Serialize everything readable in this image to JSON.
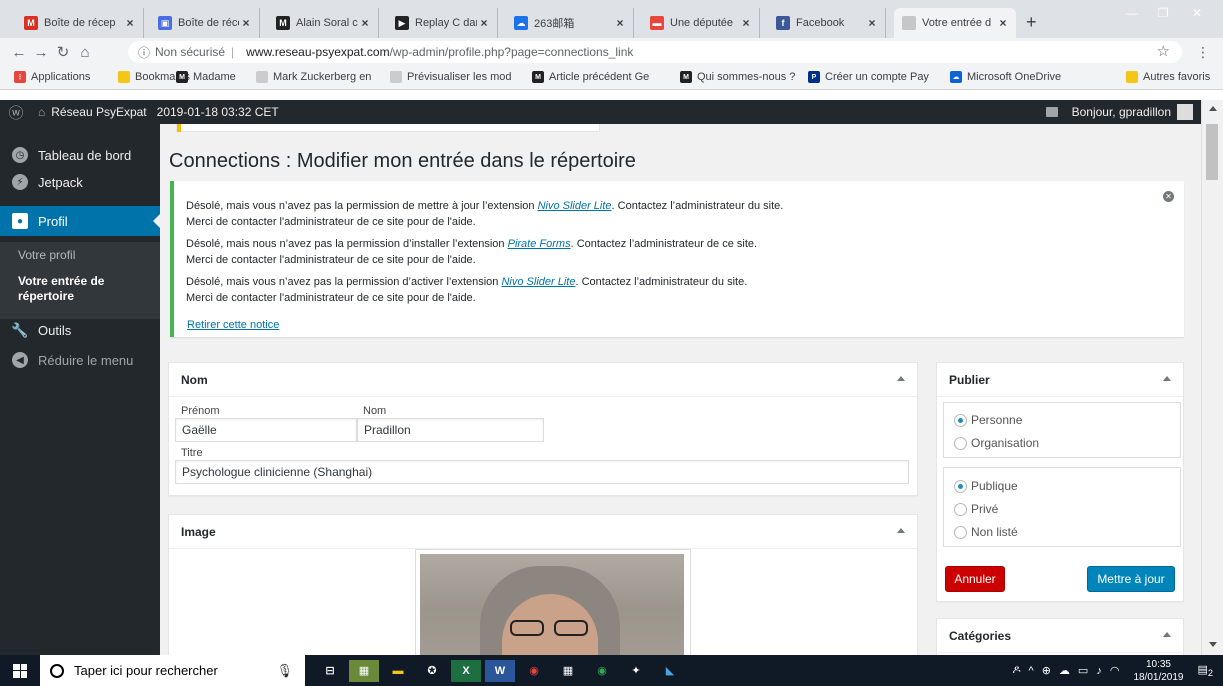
{
  "browser": {
    "tabs": [
      {
        "title": "Boîte de récep",
        "color": "#d93025",
        "glyph": "M"
      },
      {
        "title": "Boîte de récep",
        "color": "#4a6ee0",
        "glyph": "▣"
      },
      {
        "title": "Alain Soral co",
        "color": "#222",
        "glyph": "M"
      },
      {
        "title": "Replay C dans",
        "color": "#222",
        "glyph": "▶"
      },
      {
        "title": "263邮箱",
        "color": "#1a73e8",
        "glyph": "☁"
      },
      {
        "title": "Une députée",
        "color": "#e8453c",
        "glyph": "▬"
      },
      {
        "title": "Facebook",
        "color": "#3b5998",
        "glyph": "f"
      },
      {
        "title": "Votre entrée d",
        "color": "#c7c7c7",
        "glyph": ""
      }
    ],
    "address": {
      "security": "Non sécurisé",
      "host": "www.reseau-psyexpat.com",
      "path": "/wp-admin/profile.php?page=connections_link"
    },
    "bookmarks": [
      {
        "label": "Applications",
        "color": "#e8453c",
        "glyph": "⋮"
      },
      {
        "label": "Bookmarks",
        "color": "#f5c518",
        "glyph": ""
      },
      {
        "label": "Madame",
        "color": "#222",
        "glyph": "M"
      },
      {
        "label": "Mark Zuckerberg en",
        "color": "#ccc",
        "glyph": ""
      },
      {
        "label": "Prévisualiser les mod",
        "color": "#ccc",
        "glyph": ""
      },
      {
        "label": "Article précédent Ge",
        "color": "#222",
        "glyph": "M"
      },
      {
        "label": "Qui sommes-nous ?",
        "color": "#222",
        "glyph": "M"
      },
      {
        "label": "Créer un compte Pay",
        "color": "#003087",
        "glyph": "P"
      },
      {
        "label": "Microsoft OneDrive",
        "color": "#0a64d6",
        "glyph": "☁"
      },
      {
        "label": "Autres favoris",
        "color": "#f5c518",
        "glyph": ""
      }
    ]
  },
  "adminbar": {
    "site_name": "Réseau PsyExpat",
    "datetime": "2019-01-18 03:32 CET",
    "greeting": "Bonjour, gpradillon"
  },
  "sidebar": {
    "items": [
      {
        "label": "Tableau de bord",
        "icon": "dashboard-icon"
      },
      {
        "label": "Jetpack",
        "icon": "jetpack-icon"
      },
      {
        "label": "Profil",
        "icon": "user-icon"
      },
      {
        "label": "Outils",
        "icon": "wrench-icon"
      },
      {
        "label": "Réduire le menu",
        "icon": "collapse-icon"
      }
    ],
    "submenu": [
      "Votre profil",
      "Votre entrée de répertoire"
    ]
  },
  "page": {
    "title": "Connections : Modifier mon entrée dans le répertoire",
    "notices": [
      {
        "pre": "Désolé, mais vous n’avez pas la permission de mettre à jour l’extension ",
        "link": "Nivo Slider Lite",
        "post": ". Contactez l’administrateur du site.",
        "line2": "Merci de contacter l'administrateur de ce site pour de l'aide."
      },
      {
        "pre": "Désolé, mais nous n’avez pas la permission d’installer l’extension ",
        "link": "Pirate Forms",
        "post": ". Contactez l’administrateur de ce site.",
        "line2": "Merci de contacter l'administrateur de ce site pour de l'aide."
      },
      {
        "pre": "Désolé, mais vous n’avez pas la permission d’activer l’extension ",
        "link": "Nivo Slider Lite",
        "post": ". Contactez l’administrateur du site.",
        "line2": "Merci de contacter l'administrateur de ce site pour de l'aide."
      }
    ],
    "dismiss": "Retirer cette notice"
  },
  "name_box": {
    "title": "Nom",
    "first_label": "Prénom",
    "first_value": "Gaëlle",
    "last_label": "Nom",
    "last_value": "Pradillon",
    "title_label": "Titre",
    "title_value": "Psychologue clinicienne (Shanghai)"
  },
  "image_box": {
    "title": "Image"
  },
  "publish_box": {
    "title": "Publier",
    "type_options": [
      "Personne",
      "Organisation"
    ],
    "type_selected": "Personne",
    "visibility_options": [
      "Publique",
      "Privé",
      "Non listé"
    ],
    "visibility_selected": "Publique",
    "cancel": "Annuler",
    "update": "Mettre à jour"
  },
  "categories_box": {
    "title": "Catégories"
  },
  "taskbar": {
    "search_placeholder": "Taper ici pour rechercher",
    "time": "10:35",
    "date": "18/01/2019",
    "notifications": "2"
  },
  "colors": {
    "wp_dark": "#23282d",
    "wp_blue": "#0073aa",
    "notice_green": "#46b450",
    "cancel_red": "#cc0000",
    "primary": "#0085ba"
  }
}
